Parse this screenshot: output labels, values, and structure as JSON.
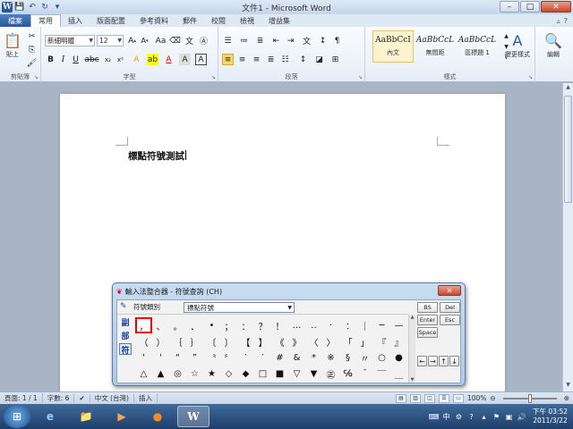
{
  "window": {
    "title": "文件1 - Microsoft Word"
  },
  "tabs": [
    "常用",
    "插入",
    "版面配置",
    "參考資料",
    "郵件",
    "校閱",
    "檢視",
    "增益集"
  ],
  "file_tab": "檔案",
  "ribbon": {
    "clipboard": {
      "paste": "貼上",
      "label": "剪貼簿"
    },
    "font": {
      "name": "新細明體",
      "size": "12",
      "label": "字型"
    },
    "paragraph": {
      "label": "段落"
    },
    "styles": {
      "label": "樣式",
      "items": [
        {
          "preview": "AaBbCcI",
          "name": "內文"
        },
        {
          "preview": "AaBbCcL",
          "name": "無間距"
        },
        {
          "preview": "AaBbCcL",
          "name": "區標題 1"
        }
      ],
      "change": "變更樣式",
      "edit": "編輯"
    }
  },
  "document": {
    "text": "標點符號測試"
  },
  "ime": {
    "title": "輸入法整合器 - 符號查詢 (CH)",
    "category_label": "符號類別",
    "category_value": "標點符號",
    "side": [
      "副",
      "部",
      "符"
    ],
    "symbols": [
      "，",
      "、",
      "。",
      "．",
      "•",
      "；",
      "：",
      "？",
      "！",
      "…",
      "‥",
      "·",
      "︰",
      "｜",
      "─",
      "—",
      "（",
      "）",
      "｛",
      "｝",
      "〔",
      "〕",
      "【",
      "】",
      "《",
      "》",
      "〈",
      "〉",
      "「",
      "」",
      "『",
      "』",
      "'",
      "'",
      "“",
      "”",
      "〝",
      "〞",
      "‵",
      "′",
      "#",
      "&",
      "*",
      "※",
      "§",
      "〃",
      "○",
      "●",
      "△",
      "▲",
      "◎",
      "☆",
      "★",
      "◇",
      "◆",
      "□",
      "■",
      "▽",
      "▼",
      "㊣",
      "℅",
      "¯",
      "￣",
      "＿"
    ],
    "keys": [
      "BS",
      "Del",
      "Enter",
      "Esc",
      "Space"
    ],
    "arrows": [
      "←",
      "→",
      "↑",
      "↓"
    ]
  },
  "statusbar": {
    "page": "頁面: 1 / 1",
    "words": "字數: 6",
    "language": "中文 (台灣)",
    "mode": "插入",
    "zoom": "100%"
  },
  "taskbar": {
    "ime_indicator": "中",
    "clock_time": "下午 03:52",
    "clock_date": "2011/3/22"
  }
}
